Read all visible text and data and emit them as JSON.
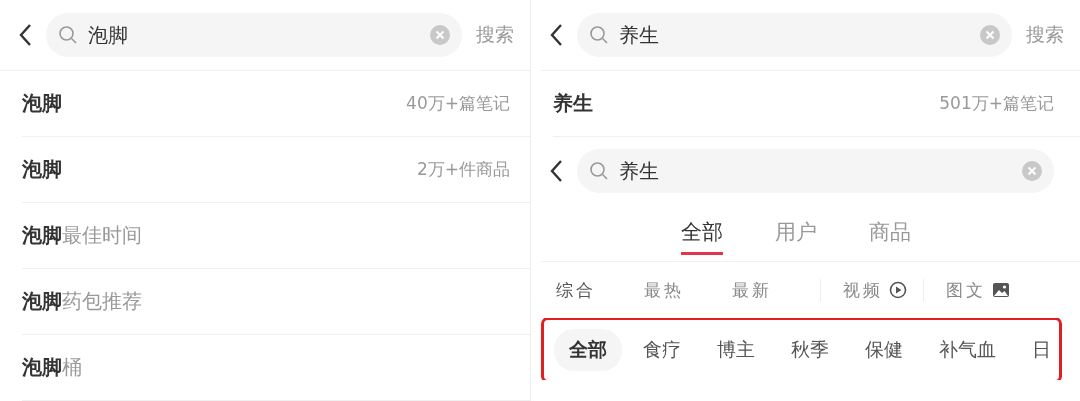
{
  "left": {
    "search": {
      "value": "泡脚",
      "action": "搜索"
    },
    "suggestions": [
      {
        "query": "泡脚",
        "count": "40万+篇笔记"
      },
      {
        "query": "泡脚",
        "count": "2万+件商品"
      },
      {
        "query": "泡脚",
        "completion": "最佳时间"
      },
      {
        "query": "泡脚",
        "completion": "药包推荐"
      },
      {
        "query": "泡脚",
        "completion": "桶"
      }
    ]
  },
  "right": {
    "search": {
      "value": "养生",
      "action": "搜索"
    },
    "suggestions": [
      {
        "query": "养生",
        "count": "501万+篇笔记"
      }
    ],
    "results": {
      "search": {
        "value": "养生"
      },
      "tabs": [
        {
          "label": "全部",
          "selected": true
        },
        {
          "label": "用户",
          "selected": false
        },
        {
          "label": "商品",
          "selected": false
        }
      ],
      "sort": [
        {
          "label": "综合",
          "kind": "sort",
          "selected": true
        },
        {
          "label": "最热",
          "kind": "sort",
          "selected": false
        },
        {
          "label": "最新",
          "kind": "sort",
          "selected": false
        },
        {
          "label": "视频",
          "kind": "video",
          "selected": false
        },
        {
          "label": "图文",
          "kind": "image",
          "selected": false
        }
      ],
      "chips": [
        {
          "label": "全部",
          "selected": true
        },
        {
          "label": "食疗",
          "selected": false
        },
        {
          "label": "博主",
          "selected": false
        },
        {
          "label": "秋季",
          "selected": false
        },
        {
          "label": "保健",
          "selected": false
        },
        {
          "label": "补气血",
          "selected": false
        },
        {
          "label": "日",
          "selected": false
        }
      ],
      "highlighted": true
    }
  }
}
